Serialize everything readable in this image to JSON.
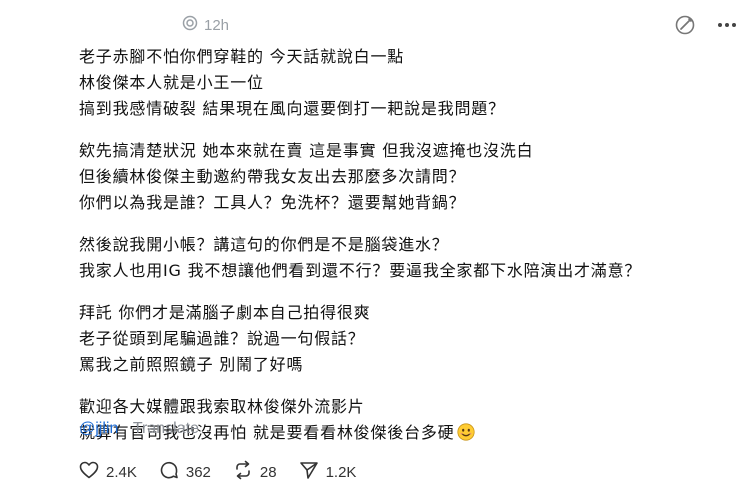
{
  "post": {
    "timestamp": "12h",
    "paragraphs": [
      [
        "老子赤腳不怕你們穿鞋的 今天話就說白一點",
        "林俊傑本人就是小王一位",
        "搞到我感情破裂 結果現在風向還要倒打一耙說是我問題？"
      ],
      [
        "欸先搞清楚狀況 她本來就在賣 這是事實 但我沒遮掩也沒洗白",
        "但後續林俊傑主動邀約帶我女友出去那麼多次請問？",
        "你們以為我是誰？工具人？免洗杯？還要幫她背鍋？"
      ],
      [
        "然後說我開小帳？講這句的你們是不是腦袋進水？",
        "我家人也用IG 我不想讓他們看到還不行？要逼我全家都下水陪演出才滿意？"
      ],
      [
        "拜託 你們才是滿腦子劇本自己拍得很爽",
        "老子從頭到尾騙過誰？說過一句假話？",
        "罵我之前照照鏡子 別鬧了好嗎"
      ],
      [
        "歡迎各大媒體跟我索取林俊傑外流影片",
        "就算有官司我也沒再怕 就是要看看林俊傑後台多硬"
      ]
    ],
    "mention": "@jjlin",
    "translate_label": "Translate"
  },
  "stats": {
    "likes": "2.4K",
    "replies": "362",
    "reposts": "28",
    "shares": "1.2K"
  },
  "icons": {
    "spiral": "threads-spiral-icon",
    "edit": "edit-icon",
    "more": "more-icon",
    "like": "heart-icon",
    "reply": "comment-icon",
    "repost": "repost-icon",
    "share": "share-icon",
    "emoji": "smiling-face-emoji"
  }
}
